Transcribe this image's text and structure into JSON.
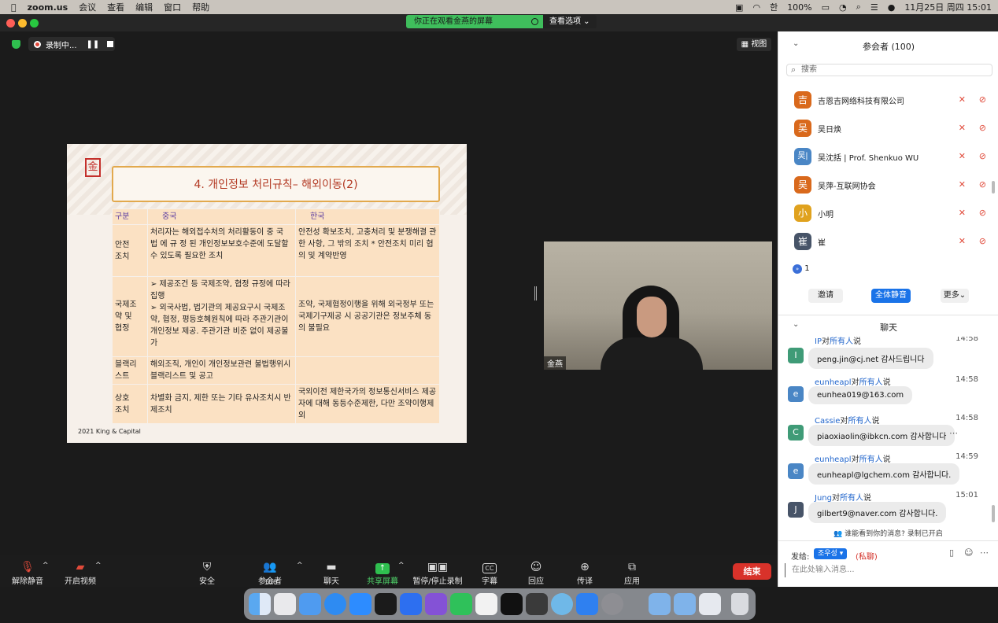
{
  "menubar": {
    "app": "zoom.us",
    "items": [
      "会议",
      "查看",
      "编辑",
      "窗口",
      "帮助"
    ],
    "battery": "100%",
    "input_method": "한",
    "datetime": "11月25日 周四  15:01"
  },
  "share_banner": {
    "label": "你正在观看金燕的屏幕",
    "options": "查看选项 ⌄"
  },
  "recording": {
    "label": "录制中..."
  },
  "view_button": "视图",
  "slide": {
    "title": "4. 개인정보 처리규칙– 해외이동(2)",
    "seal_text": "金",
    "footer": "2021 King & Capital",
    "table": {
      "headers": [
        "구분",
        "중국",
        "한국"
      ],
      "rows": [
        {
          "label": "안전\n조치",
          "china": "처리자는 해외접수처의 처리활동이 중 국 법 에 규 정 된 개인정보보호수준에 도달할 수 있도록 필요한 조치",
          "korea": "안전성 확보조치, 고충처리 및 분쟁해결 관한 사항, 그 밖의 조치 * 안전조치 미리 협의 및 계약반영"
        },
        {
          "label": "국제조\n약 및\n협정",
          "china": "➢ 제공조건 등 국제조약, 협정 규정에 따라 집행\n➢ 외국사법, 법기관의 제공요구시 국제조약, 협정, 평등호혜원칙에 따라 주관기관이 개인정보 제공. 주관기관 비준 없이 제공불가",
          "korea": "조약, 국제협정이행을 위해 외국정부 또는 국제기구제공 시 공공기관은 정보주체 동의 불필요"
        },
        {
          "label": "블랙리\n스트",
          "china": "해외조직, 개인이 개인정보관련 불법행위시 블랙리스트 및 공고",
          "korea": ""
        },
        {
          "label": "상호\n조치",
          "china": "차별화 금지, 제한 또는 기타 유사조치시 반제조치",
          "korea": "국외이전 제한국가의 정보통신서비스 제공자에 대해 동등수준제한, 다만 조약이행제외"
        }
      ]
    }
  },
  "camera": {
    "name": "金燕"
  },
  "toolbar": {
    "mute": "解除静音",
    "video": "开启视频",
    "security": "安全",
    "participants": "参会者",
    "participants_count": "100",
    "chat": "聊天",
    "share": "共享屏幕",
    "record": "暂停/停止录制",
    "captions": "字幕",
    "reactions": "回应",
    "translate": "传译",
    "apps": "应用",
    "end": "结束"
  },
  "participants_panel": {
    "title": "参会者 (100)",
    "search_placeholder": "搜索",
    "people": [
      {
        "avatar": "吉",
        "name": "吉恩吉网络科技有限公司",
        "color": "#d9691c"
      },
      {
        "avatar": "吴",
        "name": "吴日焕",
        "color": "#d9691c"
      },
      {
        "avatar": "吴|",
        "name": "吴沈括 | Prof. Shenkuo WU",
        "color": "#4a86c5"
      },
      {
        "avatar": "吴",
        "name": "吴萍-互联网协会",
        "color": "#d9691c"
      },
      {
        "avatar": "小",
        "name": "小明",
        "color": "#e0a21e"
      },
      {
        "avatar": "崔",
        "name": "崔",
        "color": "#475468"
      }
    ],
    "raised_count": "1",
    "invite": "邀请",
    "mute_all": "全体静音",
    "more": "更多⌄"
  },
  "chat_panel": {
    "title": "聊天",
    "messages": [
      {
        "sender": "IP",
        "to": "所有人",
        "time": "14:58",
        "text": "peng.jin@cj.net 감사드립니다",
        "avatar": "I",
        "color": "#3f9b77"
      },
      {
        "sender": "eunheapl",
        "to": "所有人",
        "time": "14:58",
        "text": "eunhea019@163.com",
        "avatar": "e",
        "color": "#4a86c5"
      },
      {
        "sender": "Cassie",
        "to": "所有人",
        "time": "14:58",
        "text": "piaoxiaolin@ibkcn.com 감사합니다",
        "avatar": "C",
        "color": "#3f9b77"
      },
      {
        "sender": "eunheapl",
        "to": "所有人",
        "time": "14:59",
        "text": "eunheapl@lgchem.com 감사합니다.",
        "avatar": "e",
        "color": "#4a86c5"
      },
      {
        "sender": "Jung",
        "to": "所有人",
        "time": "15:01",
        "text": "gilbert9@naver.com 감사합니다.",
        "avatar": "J",
        "color": "#475468"
      }
    ],
    "said": "说",
    "to_word": "对",
    "who_can_see": "谁能看到你的消息? 录制已开启",
    "send_to_label": "发给:",
    "send_to_value": "조우성",
    "private_tag": "(私聊)",
    "input_placeholder": "在此处输入消息..."
  }
}
